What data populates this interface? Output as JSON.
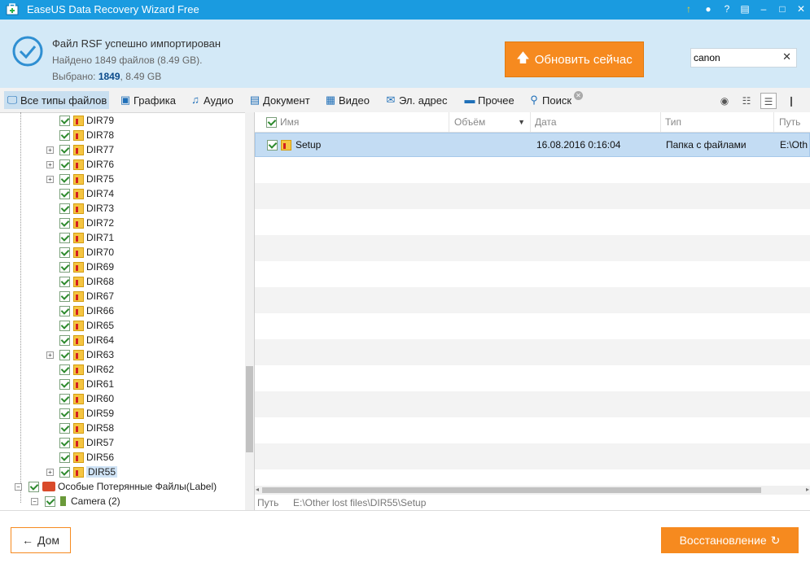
{
  "window": {
    "title": "EaseUS Data Recovery Wizard Free"
  },
  "header": {
    "status_title": "Файл RSF успешно импортирован",
    "found_text": "Найдено 1849 файлов (8.49 GB).",
    "selected_prefix": "Выбрано:",
    "selected_count": "1849",
    "selected_suffix": ", 8.49 GB",
    "upgrade_label": "Обновить сейчас",
    "search_value": "canon"
  },
  "filters": [
    {
      "label": "Все типы файлов",
      "icon": "monitor-icon"
    },
    {
      "label": "Графика",
      "icon": "image-icon"
    },
    {
      "label": "Аудио",
      "icon": "music-icon"
    },
    {
      "label": "Документ",
      "icon": "document-icon"
    },
    {
      "label": "Видео",
      "icon": "film-icon"
    },
    {
      "label": "Эл. адрес",
      "icon": "mail-icon"
    },
    {
      "label": "Прочее",
      "icon": "folder-icon"
    },
    {
      "label": "Поиск",
      "icon": "search-icon"
    }
  ],
  "tree": {
    "items": [
      "DIR79",
      "DIR78",
      "DIR77",
      "DIR76",
      "DIR75",
      "DIR74",
      "DIR73",
      "DIR72",
      "DIR71",
      "DIR70",
      "DIR69",
      "DIR68",
      "DIR67",
      "DIR66",
      "DIR65",
      "DIR64",
      "DIR63",
      "DIR62",
      "DIR61",
      "DIR60",
      "DIR59",
      "DIR58",
      "DIR57",
      "DIR56",
      "DIR55"
    ],
    "special_label": "Особые Потерянные Файлы(Label)",
    "camera_label": "Camera (2)"
  },
  "columns": {
    "name": "Имя",
    "size": "Объём",
    "date": "Дата",
    "type": "Тип",
    "path": "Путь"
  },
  "rows": [
    {
      "name": "Setup",
      "size": "",
      "date": "16.08.2016 0:16:04",
      "type": "Папка с файлами",
      "path": "E:\\Oth"
    }
  ],
  "pathbar": {
    "label": "Путь",
    "value": "E:\\Other lost files\\DIR55\\Setup"
  },
  "footer": {
    "home_label": "Дом",
    "recover_label": "Восстановление"
  },
  "colors": {
    "titlebar": "#1a9be0",
    "header_bg": "#d3e9f7",
    "accent": "#f68a1f",
    "selected_row": "#c3dcf3"
  }
}
